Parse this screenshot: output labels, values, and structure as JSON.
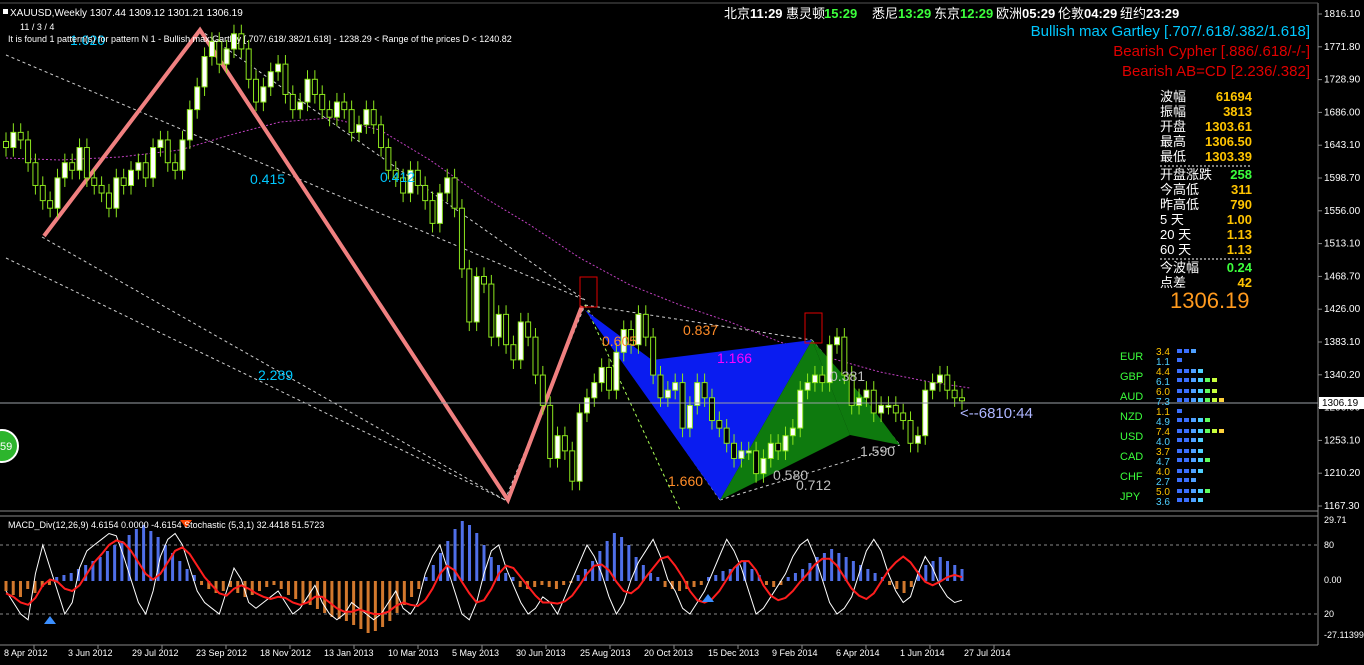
{
  "header": {
    "symbol_line": "XAUUSD,Weekly  1307.44 1309.12 1301.21 1306.19",
    "sub_line": "11 / 3 / 4",
    "pattern_line": "It is found 1 pattern(s)   for pattern N 1 - Bullish max Gartley [.707/.618/.382/1.618] - 1238.29 < Range of the prices D < 1240.82",
    "left_badge": "59"
  },
  "clocks": [
    {
      "city": "北京",
      "time": "11:29",
      "color": "#ffffff"
    },
    {
      "city": "惠灵顿",
      "time": "15:29",
      "color": "#3cff3c"
    },
    {
      "city": "悉尼",
      "time": "13:29",
      "color": "#3cff3c"
    },
    {
      "city": "东京",
      "time": "12:29",
      "color": "#3cff3c"
    },
    {
      "city": "欧洲",
      "time": "05:29",
      "color": "#ffffff"
    },
    {
      "city": "伦敦",
      "time": "04:29",
      "color": "#ffffff"
    },
    {
      "city": "纽约",
      "time": "23:29",
      "color": "#ffffff"
    }
  ],
  "patterns": [
    {
      "label": "Bullish max Gartley [.707/.618/.382/1.618]",
      "color": "#00c8ff"
    },
    {
      "label": "Bearish Cypher [.886/.618/-/-]",
      "color": "#e00000"
    },
    {
      "label": "Bearish AB=CD [2.236/.382]",
      "color": "#e00000"
    }
  ],
  "stats": [
    {
      "label": "波幅",
      "value": "61694",
      "color": "#ffc400"
    },
    {
      "label": "振幅",
      "value": "3813",
      "color": "#ffc400"
    },
    {
      "label": "开盘",
      "value": "1303.61",
      "color": "#ffc400"
    },
    {
      "label": "最高",
      "value": "1306.50",
      "color": "#ffc400"
    },
    {
      "label": "最低",
      "value": "1303.39",
      "color": "#ffc400"
    },
    {
      "label": "开盘涨跌",
      "value": "258",
      "color": "#3cff3c"
    },
    {
      "label": "今高低",
      "value": "311",
      "color": "#ffc400"
    },
    {
      "label": "昨高低",
      "value": "790",
      "color": "#ffc400"
    },
    {
      "label": "5 天",
      "value": "1.00",
      "color": "#ffc400"
    },
    {
      "label": "20 天",
      "value": "1.13",
      "color": "#ffc400"
    },
    {
      "label": "60 天",
      "value": "1.13",
      "color": "#ffc400"
    },
    {
      "label": "今波幅",
      "value": "0.24",
      "color": "#3cff3c"
    },
    {
      "label": "点差",
      "value": "42",
      "color": "#ffc400"
    }
  ],
  "big_price": "1306.19",
  "currency_strength": [
    {
      "name": "EUR",
      "top": "3.4",
      "bottom": "1.1",
      "top_bars": 3,
      "bottom_bars": 1
    },
    {
      "name": "GBP",
      "top": "4.4",
      "bottom": "6.1",
      "top_bars": 4,
      "bottom_bars": 6
    },
    {
      "name": "AUD",
      "top": "6.0",
      "bottom": "7.3",
      "top_bars": 6,
      "bottom_bars": 7
    },
    {
      "name": "NZD",
      "top": "1.1",
      "bottom": "4.9",
      "top_bars": 1,
      "bottom_bars": 5
    },
    {
      "name": "USD",
      "top": "7.4",
      "bottom": "4.0",
      "top_bars": 7,
      "bottom_bars": 4
    },
    {
      "name": "CAD",
      "top": "3.7",
      "bottom": "4.7",
      "top_bars": 4,
      "bottom_bars": 5
    },
    {
      "name": "CHF",
      "top": "4.0",
      "bottom": "2.7",
      "top_bars": 4,
      "bottom_bars": 3
    },
    {
      "name": "JPY",
      "top": "5.0",
      "bottom": "3.6",
      "top_bars": 5,
      "bottom_bars": 4
    }
  ],
  "countdown": "<--6810:44",
  "current_price_tag": "1306.19",
  "indicator_header": "MACD_Div(12,26,9) 4.6154 0.0000 -4.6154  Stochastic (5,3,1)  32.4418 51.5723",
  "chart_data": {
    "type": "candlestick",
    "timeframe": "Weekly",
    "ylim": [
      1167.3,
      1816.1
    ],
    "y_ticks": [
      "1816.10",
      "1771.80",
      "1728.90",
      "1686.00",
      "1643.10",
      "1598.70",
      "1556.00",
      "1513.10",
      "1468.70",
      "1426.00",
      "1383.10",
      "1340.20",
      "1296.00",
      "1253.10",
      "1210.20",
      "1167.30"
    ],
    "x_ticks": [
      "8 Apr 2012",
      "3 Jun 2012",
      "29 Jul 2012",
      "23 Sep 2012",
      "18 Nov 2012",
      "13 Jan 2013",
      "10 Mar 2013",
      "5 May 2013",
      "30 Jun 2013",
      "25 Aug 2013",
      "20 Oct 2013",
      "15 Dec 2013",
      "9 Feb 2014",
      "6 Apr 2014",
      "1 Jun 2014",
      "27 Jul 2014"
    ],
    "closes": [
      1640,
      1660,
      1650,
      1620,
      1590,
      1570,
      1560,
      1600,
      1620,
      1610,
      1640,
      1600,
      1590,
      1580,
      1560,
      1600,
      1590,
      1610,
      1620,
      1600,
      1640,
      1650,
      1620,
      1610,
      1650,
      1690,
      1720,
      1760,
      1780,
      1750,
      1770,
      1790,
      1770,
      1730,
      1700,
      1720,
      1740,
      1750,
      1710,
      1690,
      1700,
      1730,
      1710,
      1690,
      1680,
      1700,
      1690,
      1660,
      1670,
      1690,
      1670,
      1640,
      1610,
      1600,
      1580,
      1610,
      1590,
      1570,
      1540,
      1580,
      1600,
      1560,
      1480,
      1410,
      1470,
      1460,
      1390,
      1420,
      1380,
      1360,
      1410,
      1390,
      1340,
      1300,
      1230,
      1260,
      1240,
      1200,
      1290,
      1310,
      1330,
      1350,
      1320,
      1370,
      1400,
      1380,
      1420,
      1390,
      1340,
      1310,
      1320,
      1330,
      1270,
      1300,
      1330,
      1310,
      1280,
      1270,
      1250,
      1230,
      1240,
      1240,
      1210,
      1230,
      1250,
      1240,
      1260,
      1270,
      1320,
      1330,
      1340,
      1330,
      1380,
      1390,
      1340,
      1300,
      1310,
      1320,
      1290,
      1300,
      1300,
      1290,
      1280,
      1250,
      1260,
      1320,
      1330,
      1340,
      1320,
      1310,
      1306
    ],
    "swing_labels": [
      {
        "text": "1.020",
        "color": "#00c8ff"
      },
      {
        "text": "0.415",
        "color": "#00c8ff"
      },
      {
        "text": "0.412",
        "color": "#00c8ff"
      },
      {
        "text": "2.289",
        "color": "#00c8ff"
      },
      {
        "text": "0.605",
        "color": "#ff8c28"
      },
      {
        "text": "0.837",
        "color": "#ff8c28"
      },
      {
        "text": "1.166",
        "color": "#ff00ff"
      },
      {
        "text": "1.660",
        "color": "#ff8c28"
      },
      {
        "text": "0.381",
        "color": "#bfbfbf"
      },
      {
        "text": "0.580",
        "color": "#bfbfbf"
      },
      {
        "text": "0.712",
        "color": "#bfbfbf"
      },
      {
        "text": "1.590",
        "color": "#bfbfbf"
      }
    ],
    "indicator": {
      "y_ticks": [
        "29.71",
        "80",
        "0.00",
        "20",
        "-27.11399"
      ],
      "macd_hist": [
        -5,
        -7,
        -8,
        -4,
        -6,
        -3,
        -2,
        2,
        3,
        4,
        6,
        8,
        10,
        12,
        15,
        18,
        20,
        23,
        26,
        28,
        25,
        22,
        18,
        14,
        10,
        6,
        3,
        -2,
        -4,
        -6,
        -5,
        -3,
        -6,
        -8,
        -7,
        -5,
        -3,
        -2,
        -4,
        -7,
        -9,
        -11,
        -12,
        -14,
        -16,
        -18,
        -19,
        -20,
        -22,
        -24,
        -26,
        -25,
        -23,
        -20,
        -16,
        -12,
        -8,
        -4,
        2,
        8,
        14,
        20,
        26,
        30,
        28,
        24,
        18,
        12,
        8,
        4,
        2,
        -3,
        -4,
        -3,
        -2,
        -3,
        -4,
        -2,
        -1,
        3,
        6,
        10,
        15,
        20,
        24,
        22,
        18,
        12,
        8,
        4,
        2,
        -3,
        -4,
        -5,
        -4,
        -3,
        -2,
        2,
        3,
        5,
        6,
        8,
        10,
        6,
        3,
        -2,
        -3,
        -2,
        2,
        4,
        6,
        9,
        12,
        14,
        16,
        14,
        12,
        10,
        8,
        6,
        4,
        2,
        -2,
        -4,
        -6,
        -3,
        5,
        8,
        10,
        12,
        10,
        8,
        6
      ],
      "stoch": [
        40,
        30,
        20,
        15,
        55,
        80,
        60,
        40,
        20,
        30,
        60,
        75,
        80,
        85,
        90,
        88,
        70,
        50,
        30,
        20,
        40,
        70,
        85,
        90,
        80,
        60,
        40,
        30,
        25,
        20,
        40,
        60,
        50,
        30,
        25,
        30,
        35,
        40,
        30,
        20,
        25,
        35,
        45,
        30,
        20,
        15,
        20,
        30,
        25,
        20,
        15,
        20,
        30,
        40,
        25,
        20,
        30,
        55,
        70,
        80,
        60,
        40,
        20,
        15,
        30,
        55,
        75,
        80,
        60,
        45,
        30,
        20,
        25,
        35,
        30,
        20,
        35,
        50,
        65,
        80,
        70,
        55,
        35,
        20,
        30,
        50,
        65,
        75,
        85,
        70,
        50,
        40,
        25,
        20,
        30,
        40,
        55,
        70,
        85,
        75,
        60,
        40,
        20,
        25,
        35,
        45,
        55,
        70,
        80,
        85,
        70,
        50,
        30,
        20,
        25,
        35,
        55,
        75,
        85,
        75,
        55,
        40,
        30,
        35,
        55,
        70,
        60,
        45,
        35,
        30,
        32
      ],
      "signal": [
        38,
        35,
        30,
        28,
        34,
        45,
        50,
        48,
        42,
        40,
        45,
        55,
        65,
        72,
        80,
        84,
        82,
        75,
        65,
        55,
        50,
        55,
        65,
        75,
        78,
        72,
        62,
        52,
        45,
        38,
        36,
        42,
        45,
        42,
        38,
        35,
        33,
        35,
        34,
        30,
        28,
        30,
        35,
        35,
        30,
        25,
        22,
        22,
        24,
        22,
        20,
        20,
        22,
        27,
        30,
        28,
        27,
        32,
        42,
        55,
        62,
        58,
        48,
        38,
        30,
        32,
        42,
        55,
        62,
        60,
        52,
        44,
        36,
        30,
        30,
        29,
        31,
        36,
        45,
        55,
        62,
        63,
        58,
        48,
        40,
        38,
        43,
        52,
        60,
        68,
        70,
        62,
        52,
        40,
        32,
        30,
        33,
        40,
        50,
        60,
        66,
        66,
        58,
        45,
        36,
        32,
        34,
        40,
        48,
        55,
        63,
        68,
        68,
        62,
        52,
        42,
        36,
        33,
        38,
        48,
        58,
        65,
        70,
        65,
        56,
        48,
        45,
        48,
        52,
        54,
        52
      ]
    }
  }
}
